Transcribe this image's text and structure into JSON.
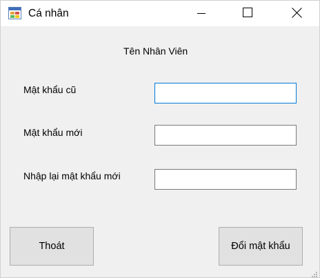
{
  "window": {
    "title": "Cá nhân",
    "icon": "form-app-icon",
    "controls": {
      "minimize": "minimize-icon",
      "maximize": "maximize-icon",
      "close": "close-icon"
    }
  },
  "form": {
    "employee_name": "Tên Nhân Viên",
    "old_password_label": "Mật khẩu cũ",
    "new_password_label": "Mật khẩu mới",
    "confirm_password_label": "Nhập lại mật khẩu mới",
    "old_password_value": "",
    "new_password_value": "",
    "confirm_password_value": ""
  },
  "buttons": {
    "exit_label": "Thoát",
    "change_label": "Đổi mật khẩu"
  },
  "colors": {
    "focus_border": "#0078d7",
    "button_bg": "#e1e1e1",
    "form_bg": "#f0f0f0"
  }
}
